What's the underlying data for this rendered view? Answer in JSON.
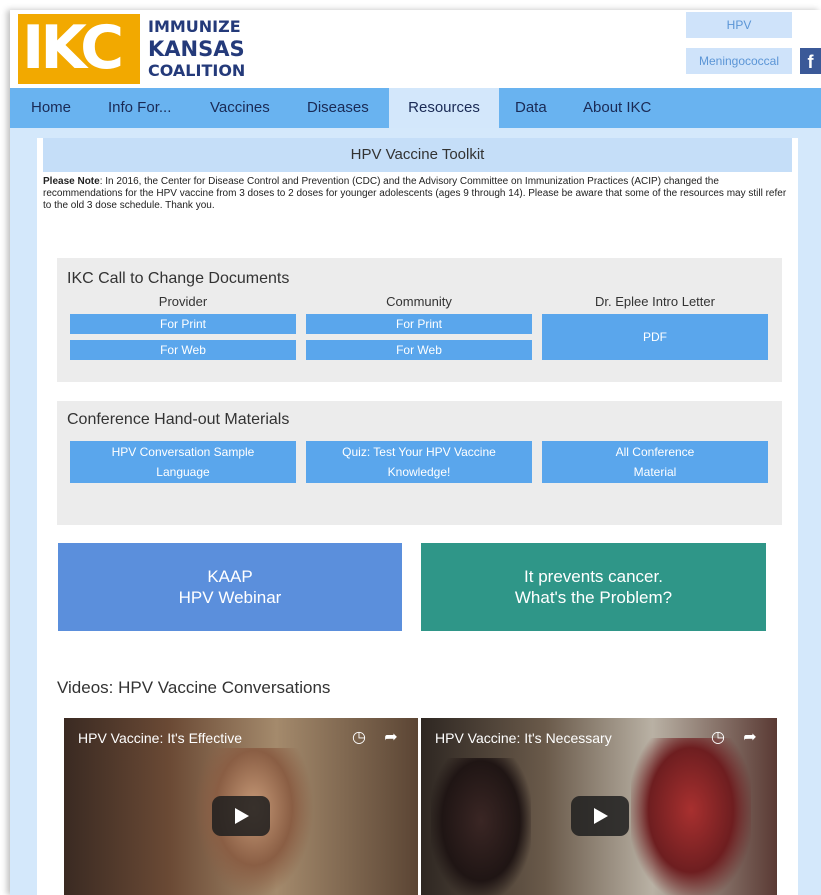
{
  "header": {
    "logo_letters": "IKC",
    "logo_line1": "IMMUNIZE",
    "logo_line2": "KANSAS",
    "logo_line3": "COALITION",
    "quick_links": [
      "HPV",
      "Meningococcal"
    ],
    "facebook_glyph": "f"
  },
  "nav": {
    "items": [
      "Home",
      "Info For...",
      "Vaccines",
      "Diseases",
      "Resources",
      "Data",
      "About IKC"
    ],
    "active": "Resources"
  },
  "toolkit": {
    "title": "HPV Vaccine Toolkit",
    "note_label": "Please Note",
    "note_text": ": In 2016, the Center for Disease Control and Prevention (CDC) and the Advisory Committee on Immunization Practices (ACIP) changed the recommendations for the HPV vaccine from 3 doses to 2 doses for younger adolescents (ages 9 through 14). Please be aware that some of the resources may still refer to the old 3 dose schedule. Thank you."
  },
  "call_to_change": {
    "title": "IKC Call to Change Documents",
    "columns": [
      {
        "heading": "Provider",
        "buttons": [
          "For Print",
          "For Web"
        ]
      },
      {
        "heading": "Community",
        "buttons": [
          "For Print",
          "For Web"
        ]
      },
      {
        "heading": "Dr. Eplee Intro Letter",
        "buttons": [
          "PDF"
        ]
      }
    ]
  },
  "conference": {
    "title": "Conference Hand-out Materials",
    "buttons": [
      {
        "line1": "HPV Conversation Sample",
        "line2": "Language"
      },
      {
        "line1": "Quiz: Test Your HPV Vaccine",
        "line2": "Knowledge!"
      },
      {
        "line1": "All Conference",
        "line2": "Material"
      }
    ]
  },
  "promos": [
    {
      "line1": "KAAP",
      "line2": "HPV Webinar",
      "color": "#5b8fdc"
    },
    {
      "line1": "It prevents cancer.",
      "line2": "What's the Problem?",
      "color": "#2f9688"
    }
  ],
  "videos": {
    "title": "Videos: HPV Vaccine Conversations",
    "items": [
      {
        "title": "HPV Vaccine: It's Effective",
        "icons": [
          "clock-icon",
          "share-icon",
          "play-icon"
        ]
      },
      {
        "title": "HPV Vaccine: It's Necessary",
        "icons": [
          "clock-icon",
          "share-icon",
          "play-icon"
        ]
      }
    ]
  },
  "colors": {
    "nav_bg": "#69b3f0",
    "button_blue": "#5aa6ec",
    "logo_orange": "#f2a900",
    "logo_navy": "#243a7a"
  }
}
